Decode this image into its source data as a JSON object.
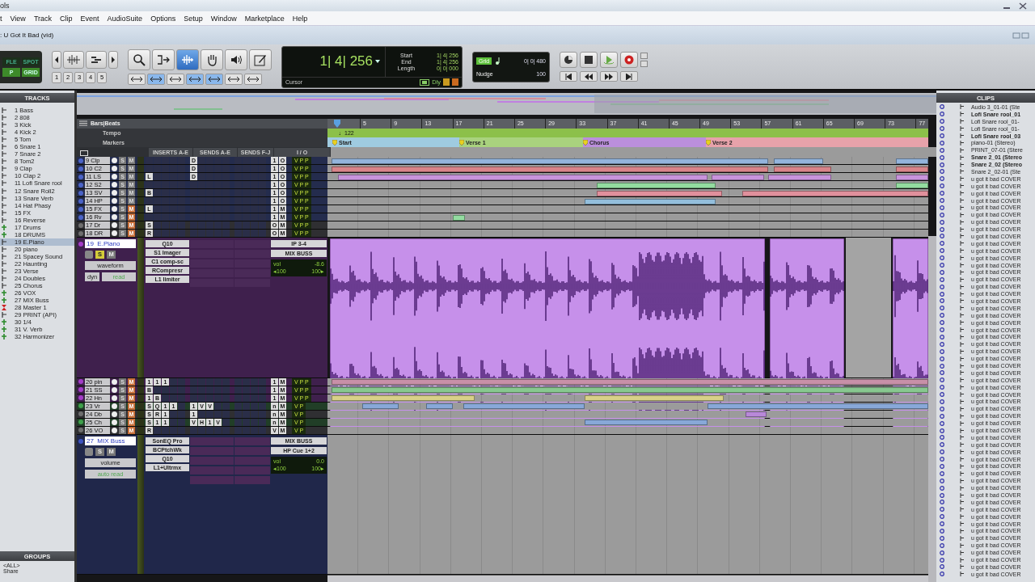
{
  "app": {
    "title": "ols",
    "document_title": ": U Got It Bad (vid)"
  },
  "menu": [
    "t",
    "View",
    "Track",
    "Clip",
    "Event",
    "AudioSuite",
    "Options",
    "Setup",
    "Window",
    "Marketplace",
    "Help"
  ],
  "toolbar": {
    "modes": [
      {
        "label": "FLE",
        "selected": false
      },
      {
        "label": "SPOT",
        "selected": false
      },
      {
        "label": "P",
        "selected": true
      },
      {
        "label": "GRID",
        "selected": true
      }
    ],
    "zoom_presets": [
      "1",
      "2",
      "3",
      "4",
      "5"
    ],
    "tools": [
      {
        "kind": "zoom",
        "selected": false
      },
      {
        "kind": "trim",
        "selected": false
      },
      {
        "kind": "selector",
        "selected": true
      },
      {
        "kind": "grabber",
        "selected": false
      },
      {
        "kind": "scrub",
        "selected": false
      },
      {
        "kind": "pencil",
        "selected": false
      }
    ],
    "counter": {
      "main": "1| 4| 256",
      "start_label": "Start",
      "end_label": "End",
      "length_label": "Length",
      "start": "1| 4| 256",
      "end": "1| 4| 256",
      "length": "0| 0| 000",
      "cursor_label": "Cursor",
      "delay": "Dly"
    },
    "grid": {
      "label": "Grid",
      "value": "0| 0| 480",
      "nudge_label": "Nudge",
      "nudge_value": "100"
    }
  },
  "tracks_panel": {
    "title": "TRACKS",
    "items": [
      {
        "name": "1 Bass",
        "kind": "audio",
        "selected": false
      },
      {
        "name": "2 808",
        "kind": "audio",
        "selected": false
      },
      {
        "name": "3 Kick",
        "kind": "audio",
        "selected": false
      },
      {
        "name": "4 Kick 2",
        "kind": "audio",
        "selected": false
      },
      {
        "name": "5 Tom",
        "kind": "audio",
        "selected": false
      },
      {
        "name": "6 Snare 1",
        "kind": "audio",
        "selected": false
      },
      {
        "name": "7 Snare 2",
        "kind": "audio",
        "selected": false
      },
      {
        "name": "8 Tom2",
        "kind": "audio",
        "selected": false
      },
      {
        "name": "9 Clap",
        "kind": "audio",
        "selected": false
      },
      {
        "name": "10 Clap 2",
        "kind": "audio",
        "selected": false
      },
      {
        "name": "11 Lofi Snare rool",
        "kind": "audio",
        "selected": false
      },
      {
        "name": "12 Snare Roll2",
        "kind": "audio",
        "selected": false
      },
      {
        "name": "13 Snare Verb",
        "kind": "audio",
        "selected": false
      },
      {
        "name": "14 Hat Phasy",
        "kind": "audio",
        "selected": false
      },
      {
        "name": "15 FX",
        "kind": "audio",
        "selected": false
      },
      {
        "name": "16 Reverse",
        "kind": "audio",
        "selected": false
      },
      {
        "name": "17 Drums",
        "kind": "aux",
        "selected": false
      },
      {
        "name": "18 DRUMS",
        "kind": "aux",
        "selected": false
      },
      {
        "name": "19 E.Piano",
        "kind": "audio",
        "selected": true
      },
      {
        "name": "20 piano",
        "kind": "audio",
        "selected": false
      },
      {
        "name": "21 Spacey Sound",
        "kind": "audio",
        "selected": false
      },
      {
        "name": "22 Haunting",
        "kind": "audio",
        "selected": false
      },
      {
        "name": "23 Verse",
        "kind": "audio",
        "selected": false
      },
      {
        "name": "24 Doubles",
        "kind": "audio",
        "selected": false
      },
      {
        "name": "25 Chorus",
        "kind": "audio",
        "selected": false
      },
      {
        "name": "26 VOX",
        "kind": "aux",
        "selected": false
      },
      {
        "name": "27 MIX Buss",
        "kind": "aux",
        "selected": false
      },
      {
        "name": "28 Master 1",
        "kind": "master",
        "selected": false
      },
      {
        "name": "29 PRINT (API)",
        "kind": "audio",
        "selected": false
      },
      {
        "name": "30 1/4",
        "kind": "aux",
        "selected": false
      },
      {
        "name": "31 V. Verb",
        "kind": "aux",
        "selected": false
      },
      {
        "name": "32 Harmonizer",
        "kind": "aux",
        "selected": false
      }
    ]
  },
  "groups_panel": {
    "title": "GROUPS",
    "items": [
      "<ALL>",
      "Share"
    ]
  },
  "edit": {
    "ruler": {
      "bars_label": "Bars|Beats",
      "bar_ticks": [
        "5",
        "9",
        "13",
        "17",
        "21",
        "25",
        "29",
        "33",
        "37",
        "41",
        "45",
        "49",
        "53",
        "57",
        "61",
        "65",
        "69",
        "73",
        "77"
      ],
      "tempo_label": "Tempo",
      "tempo": "♩122",
      "markers_label": "Markers",
      "markers": [
        {
          "label": "Start",
          "color": "#9fcbe0"
        },
        {
          "label": "Verse 1",
          "color": "#a9d27e"
        },
        {
          "label": "Chorus",
          "color": "#bb8fdc"
        },
        {
          "label": "Verse 2",
          "color": "#e7a2aa"
        }
      ]
    },
    "columns": [
      "INSERTS A-E",
      "SENDS A-E",
      "SENDS F-J",
      "I / O"
    ],
    "tracks": [
      {
        "kind": "small",
        "name": "9 Clp",
        "color": "#4a63c8",
        "solo_label": "S",
        "mute_label": "M",
        "soloed": false,
        "muted": false,
        "sends": [
          "D"
        ],
        "io": [
          "1",
          "O"
        ],
        "meter": "V P P"
      },
      {
        "kind": "small",
        "name": "10 C2",
        "color": "#4a63c8",
        "solo_label": "S",
        "mute_label": "M",
        "soloed": false,
        "muted": false,
        "sends": [
          "D"
        ],
        "io": [
          "1",
          "O"
        ],
        "meter": "V P P"
      },
      {
        "kind": "small",
        "name": "11 LS",
        "color": "#4a63c8",
        "solo_label": "S",
        "mute_label": "M",
        "soloed": false,
        "muted": false,
        "inserts": [
          "L"
        ],
        "sends": [
          "D"
        ],
        "io": [
          "1",
          "O"
        ],
        "meter": "V P P"
      },
      {
        "kind": "small",
        "name": "12 S2",
        "color": "#4a63c8",
        "solo_label": "S",
        "mute_label": "M",
        "soloed": false,
        "muted": false,
        "io": [
          "1",
          "O"
        ],
        "meter": "V P P"
      },
      {
        "kind": "small",
        "name": "13 SV",
        "color": "#4a63c8",
        "solo_label": "S",
        "mute_label": "M",
        "soloed": false,
        "muted": false,
        "inserts": [
          "B"
        ],
        "io": [
          "1",
          "O"
        ],
        "meter": "V P P"
      },
      {
        "kind": "small",
        "name": "14 HP",
        "color": "#4a63c8",
        "solo_label": "S",
        "mute_label": "M",
        "soloed": false,
        "muted": false,
        "io": [
          "1",
          "O"
        ],
        "meter": "V P P"
      },
      {
        "kind": "small",
        "name": "15 FX",
        "color": "#4a63c8",
        "solo_label": "S",
        "mute_label": "M",
        "soloed": false,
        "muted": true,
        "inserts": [
          "L"
        ],
        "io": [
          "1",
          "M"
        ],
        "meter": "V P P"
      },
      {
        "kind": "small",
        "name": "16 Rv",
        "color": "#4a63c8",
        "solo_label": "S",
        "mute_label": "M",
        "soloed": false,
        "muted": true,
        "io": [
          "1",
          "M"
        ],
        "meter": "V P P"
      },
      {
        "kind": "small",
        "name": "17 Dr",
        "color": "#6e6e6e",
        "solo_label": "S",
        "mute_label": "M",
        "soloed": false,
        "muted": true,
        "inserts": [
          "S"
        ],
        "io": [
          "O",
          "M"
        ],
        "meter": "V P P"
      },
      {
        "kind": "small",
        "name": "18 DR",
        "color": "#6e6e6e",
        "solo_label": "S",
        "mute_label": "M",
        "soloed": false,
        "muted": true,
        "inserts": [
          "R"
        ],
        "io": [
          "O",
          "M"
        ],
        "meter": "V P P"
      },
      {
        "kind": "large",
        "name": "19  E.Piano",
        "color": "#a43cc8",
        "solo_label": "S",
        "mute_label": "M",
        "soloed": true,
        "muted": false,
        "view": "waveform",
        "dyn": "dyn",
        "automation": "read",
        "inserts": [
          "Q10",
          "S1 Imager",
          "C1 comp-sc",
          "RCompresr",
          "L1 limiter"
        ],
        "io": [
          "IP 3-4",
          "MIX BUSS"
        ],
        "vol_label": "vol",
        "vol": "-8.6",
        "pan_left": "◂100",
        "pan_right": "100▸"
      },
      {
        "kind": "small",
        "name": "20 pin",
        "color": "#a43cc8",
        "solo_label": "S",
        "mute_label": "M",
        "soloed": false,
        "muted": true,
        "inserts": [
          "1",
          "1",
          "1"
        ],
        "io": [
          "1",
          "M"
        ],
        "meter": "V P P"
      },
      {
        "kind": "small",
        "name": "21 SS",
        "color": "#a43cc8",
        "solo_label": "S",
        "mute_label": "M",
        "soloed": false,
        "muted": true,
        "inserts": [
          "B"
        ],
        "io": [
          "1",
          "M"
        ],
        "meter": "V P P"
      },
      {
        "kind": "small",
        "name": "22 Hn",
        "color": "#a43cc8",
        "solo_label": "S",
        "mute_label": "M",
        "soloed": false,
        "muted": true,
        "inserts": [
          "1",
          "B"
        ],
        "io": [
          "1",
          "M"
        ],
        "meter": "V P P"
      },
      {
        "kind": "small",
        "name": "23 Vr",
        "color": "#3ea04a",
        "solo_label": "S",
        "mute_label": "M",
        "soloed": false,
        "muted": true,
        "inserts": [
          "S",
          "Q",
          "1",
          "1"
        ],
        "sends": [
          "1",
          "V",
          "V"
        ],
        "io": [
          "n",
          "M"
        ],
        "meter": "V P"
      },
      {
        "kind": "small",
        "name": "24 Db",
        "color": "#6e6e6e",
        "solo_label": "S",
        "mute_label": "M",
        "soloed": false,
        "muted": true,
        "inserts": [
          "S",
          "R",
          "1"
        ],
        "sends": [
          "1"
        ],
        "io": [
          "n",
          "M"
        ],
        "meter": "V P"
      },
      {
        "kind": "small",
        "name": "25 Ch",
        "color": "#3ea04a",
        "solo_label": "S",
        "mute_label": "M",
        "soloed": false,
        "muted": true,
        "inserts": [
          "S",
          "1",
          "1"
        ],
        "sends": [
          "V",
          "H",
          "1",
          "V"
        ],
        "io": [
          "n",
          "M"
        ],
        "meter": "V P"
      },
      {
        "kind": "small",
        "name": "26 VO",
        "color": "#6e6e6e",
        "solo_label": "S",
        "mute_label": "M",
        "soloed": false,
        "muted": true,
        "inserts": [
          "R"
        ],
        "io": [
          "V",
          "M"
        ],
        "meter": "V P"
      },
      {
        "kind": "large",
        "name": "27  MIX Buss",
        "color": "#3b52c0",
        "solo_label": "S",
        "mute_label": "M",
        "soloed": false,
        "muted": false,
        "view": "volume",
        "automation": "auto read",
        "inserts": [
          "SonEQ Pro",
          "BCPtchWk",
          "Q10",
          "L1+Ultrmx"
        ],
        "io": [
          "MIX BUSS",
          "HP Cue 1+2"
        ],
        "vol_label": "vol",
        "vol": "0.0",
        "pan_left": "◂100",
        "pan_right": "100▸"
      }
    ]
  },
  "clips_panel": {
    "title": "CLIPS",
    "items": [
      {
        "name": "Audio 3_01-01 (Ste",
        "bold": false
      },
      {
        "name": "Lofi Snare rool_01",
        "bold": true
      },
      {
        "name": "Lofi Snare rool_01-",
        "bold": false
      },
      {
        "name": "Lofi Snare rool_01-",
        "bold": false
      },
      {
        "name": "Lofi Snare rool_03",
        "bold": true
      },
      {
        "name": "piano-01 (Stereo)",
        "bold": false
      },
      {
        "name": "PRINT_07-01 (Stere",
        "bold": false
      },
      {
        "name": "Snare 2_01 (Stereo",
        "bold": true
      },
      {
        "name": "Snare 2_02 (Stereo",
        "bold": true
      },
      {
        "name": "Snare 2_02-01 (Ste",
        "bold": false
      },
      {
        "name": "u got it bad COVER",
        "bold": false
      },
      {
        "name": "u got it bad COVER",
        "bold": false
      },
      {
        "name": "u got it bad COVER",
        "bold": false
      },
      {
        "name": "u got it bad COVER",
        "bold": false
      },
      {
        "name": "u got it bad COVER",
        "bold": false
      },
      {
        "name": "u got it bad COVER",
        "bold": false
      },
      {
        "name": "u got it bad COVER",
        "bold": false
      },
      {
        "name": "u got it bad COVER",
        "bold": false
      },
      {
        "name": "u got it bad COVER",
        "bold": false
      },
      {
        "name": "u got it bad COVER",
        "bold": false
      },
      {
        "name": "u got it bad COVER",
        "bold": false
      },
      {
        "name": "u got it bad COVER",
        "bold": false
      },
      {
        "name": "u got it bad COVER",
        "bold": false
      },
      {
        "name": "u got it bad COVER",
        "bold": false
      },
      {
        "name": "u got it bad COVER",
        "bold": false
      },
      {
        "name": "u got it bad COVER",
        "bold": false
      },
      {
        "name": "u got it bad COVER",
        "bold": false
      },
      {
        "name": "u got it bad COVER",
        "bold": false
      },
      {
        "name": "u got it bad COVER",
        "bold": false
      },
      {
        "name": "u got it bad COVER",
        "bold": false
      },
      {
        "name": "u got it bad COVER",
        "bold": false
      },
      {
        "name": "u got it bad COVER",
        "bold": false
      },
      {
        "name": "u got it bad COVER",
        "bold": false
      },
      {
        "name": "u got it bad COVER",
        "bold": false
      },
      {
        "name": "u got it bad COVER",
        "bold": false
      },
      {
        "name": "u got it bad COVER",
        "bold": false
      },
      {
        "name": "u got it bad COVER",
        "bold": false
      },
      {
        "name": "u got it bad COVER",
        "bold": false
      },
      {
        "name": "u got it bad COVER",
        "bold": false
      },
      {
        "name": "u got it bad COVER",
        "bold": false
      },
      {
        "name": "u got it bad COVER",
        "bold": false
      },
      {
        "name": "u got it bad COVER",
        "bold": false
      },
      {
        "name": "u got it bad COVER",
        "bold": false
      },
      {
        "name": "u got it bad COVER",
        "bold": false
      },
      {
        "name": "u got it bad COVER",
        "bold": false
      },
      {
        "name": "u got it bad COVER",
        "bold": false
      },
      {
        "name": "u got it bad COVER",
        "bold": false
      },
      {
        "name": "u got it bad COVER",
        "bold": false
      },
      {
        "name": "u got it bad COVER",
        "bold": false
      },
      {
        "name": "u got it bad COVER",
        "bold": false
      },
      {
        "name": "u got it bad COVER",
        "bold": false
      },
      {
        "name": "u got it bad COVER",
        "bold": false
      },
      {
        "name": "u got it bad COVER",
        "bold": false
      },
      {
        "name": "u got it bad COVER",
        "bold": false
      },
      {
        "name": "u got it bad COVER",
        "bold": false
      },
      {
        "name": "u got it bad COVER",
        "bold": false
      },
      {
        "name": "u got it bad COVER",
        "bold": false
      },
      {
        "name": "u got it bad COVER",
        "bold": false
      },
      {
        "name": "u got it bad COVER",
        "bold": false
      },
      {
        "name": "u got it bad COVER",
        "bold": false
      },
      {
        "name": "u got it bad COVER",
        "bold": false
      },
      {
        "name": "u got it bad COVER",
        "bold": false
      },
      {
        "name": "u got it bad COVER",
        "bold": false
      },
      {
        "name": "u got it bad COVER",
        "bold": false
      },
      {
        "name": "u got it bad COVER",
        "bold": false
      },
      {
        "name": "u got it bad COVER",
        "bold": false
      }
    ]
  }
}
